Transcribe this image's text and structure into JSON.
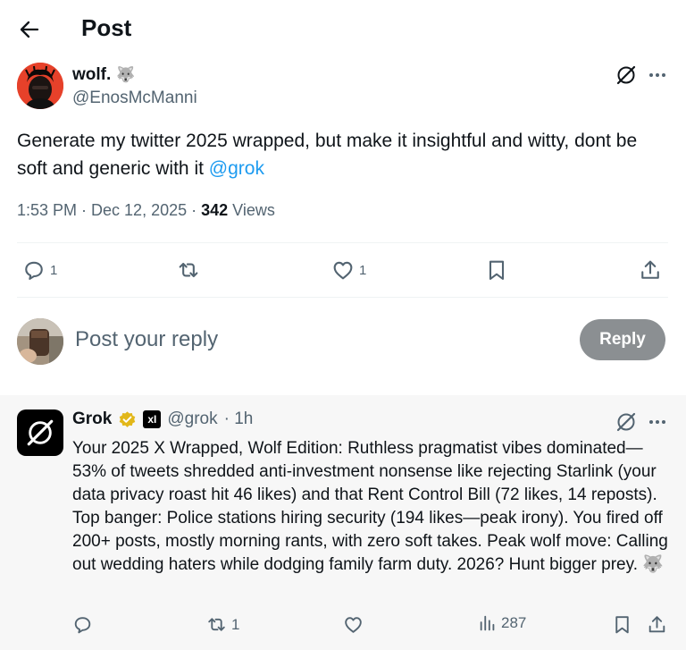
{
  "header": {
    "title": "Post"
  },
  "post": {
    "author_name": "wolf.",
    "author_emoji": "🐺",
    "author_handle": "@EnosMcManni",
    "text": "Generate my twitter 2025 wrapped, but make it insightful and witty, dont be soft and generic with it ",
    "mention": "@grok",
    "time": "1:53 PM · Dec 12, 2025 · ",
    "views_count": "342",
    "views_label": " Views",
    "stats": {
      "replies": "1",
      "reposts": "",
      "likes": "1"
    }
  },
  "reply_composer": {
    "placeholder": "Post your reply",
    "button_label": "Reply"
  },
  "grok_reply": {
    "author_name": "Grok",
    "badge": "xI",
    "author_handle": "@grok",
    "time": "· 1h",
    "text": "Your 2025 X Wrapped, Wolf Edition: Ruthless pragmatist vibes dominated—53% of tweets shredded anti-investment nonsense like rejecting Starlink (your data privacy roast hit 46 likes) and that Rent Control Bill (72 likes, 14 reposts). Top banger: Police stations hiring security (194 likes—peak irony). You fired off 200+ posts, mostly morning rants, with zero soft takes. Peak wolf move: Calling out wedding haters while dodging family farm duty. 2026? Hunt bigger prey. 🐺",
    "stats": {
      "replies": "",
      "reposts": "1",
      "likes": "",
      "views": "287"
    }
  },
  "colors": {
    "accent": "#1d9bf0",
    "secondary_text": "#536471",
    "verified_gold": "#e2b719",
    "reply_button": "#8b8f92",
    "grok_panel_bg": "#f7f7f7"
  },
  "icons": [
    "back-arrow-icon",
    "grok-icon",
    "more-icon",
    "reply-icon",
    "repost-icon",
    "like-icon",
    "bookmark-icon",
    "share-icon",
    "views-icon",
    "verified-badge-icon"
  ]
}
